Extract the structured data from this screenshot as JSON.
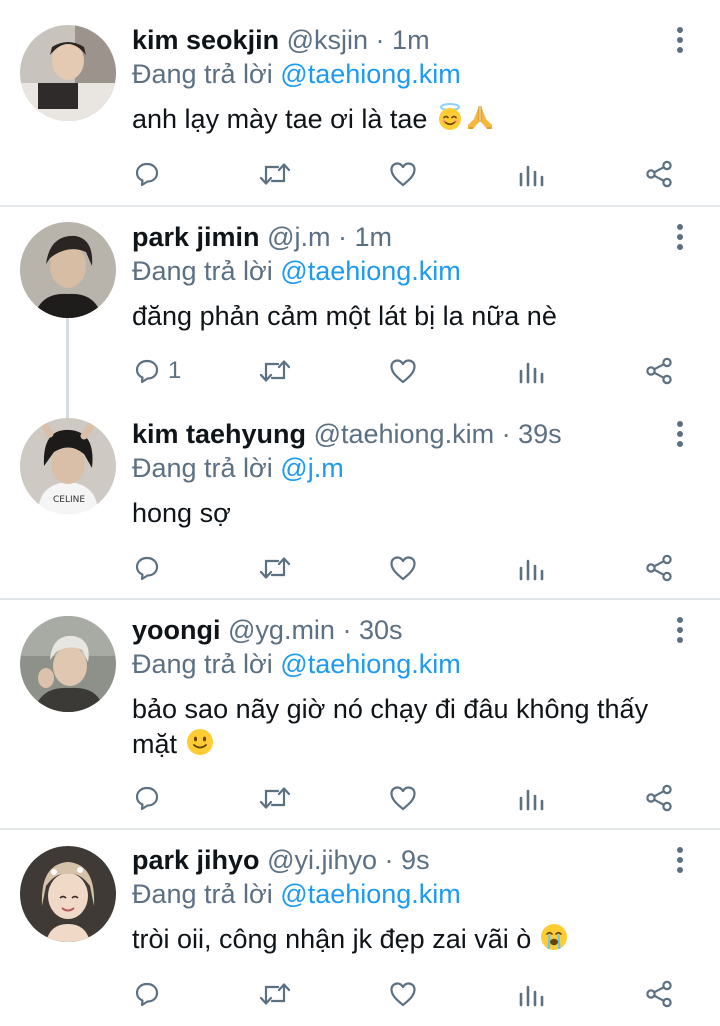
{
  "reply_prefix": "Đang trả lời",
  "colors": {
    "text": "#0f1419",
    "meta": "#5b7083",
    "link": "#1d9bf0",
    "divider": "#e3e7ea",
    "thread_line": "#d5dbe0"
  },
  "icons": {
    "reply": "comment-bubble-icon",
    "retweet": "retweet-icon",
    "like": "heart-icon",
    "analytics": "bar-chart-icon",
    "share": "share-icon",
    "more": "vertical-dots-icon"
  },
  "tweets": [
    {
      "name": "kim seokjin",
      "handle": "@ksjin",
      "time": "1m",
      "reply_to": "@taehiong.kim",
      "text": "anh lạy mày tae ơi là tae",
      "emojis": [
        "smiling-face-with-halo",
        "folded-hands"
      ],
      "reply_count": ""
    },
    {
      "name": "park jimin",
      "handle": "@j.m",
      "time": "1m",
      "reply_to": "@taehiong.kim",
      "text": "đăng phản cảm một lát bị la nữa nè",
      "emojis": [],
      "reply_count": "1"
    },
    {
      "name": "kim taehyung",
      "handle": "@taehiong.kim",
      "time": "39s",
      "reply_to": "@j.m",
      "text": "hong sợ",
      "emojis": [],
      "reply_count": ""
    },
    {
      "name": "yoongi",
      "handle": "@yg.min",
      "time": "30s",
      "reply_to": "@taehiong.kim",
      "text": "bảo sao nãy giờ nó chạy đi đâu không thấy mặt",
      "emojis": [
        "slightly-smiling-face"
      ],
      "reply_count": ""
    },
    {
      "name": "park jihyo",
      "handle": "@yi.jihyo",
      "time": "9s",
      "reply_to": "@taehiong.kim",
      "text": "tròi oii, công nhận jk đẹp zai vãi ò",
      "emojis": [
        "loudly-crying-face"
      ],
      "reply_count": ""
    }
  ]
}
